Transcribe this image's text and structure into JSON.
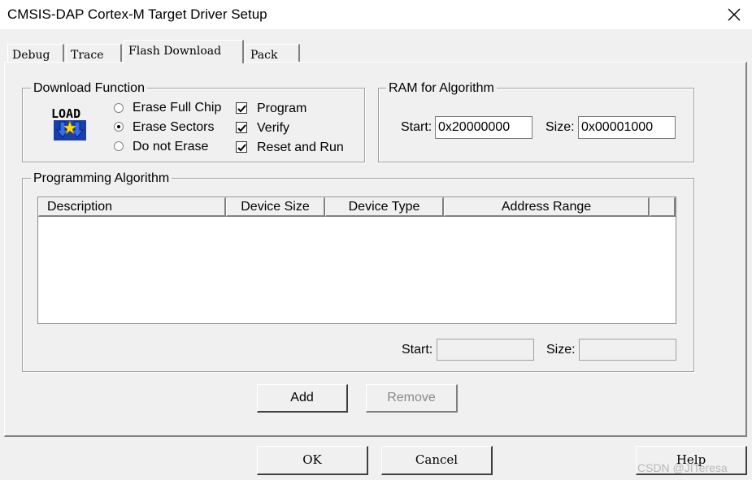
{
  "window": {
    "title": "CMSIS-DAP Cortex-M Target Driver Setup",
    "close_icon": "close-icon"
  },
  "tabs": [
    {
      "label": "Debug",
      "active": false
    },
    {
      "label": "Trace",
      "active": false
    },
    {
      "label": "Flash Download",
      "active": true
    },
    {
      "label": "Pack",
      "active": false
    }
  ],
  "download_function": {
    "label": "Download Function",
    "icon": "load-icon",
    "icon_text": "LOAD",
    "radios": [
      {
        "label": "Erase Full Chip",
        "checked": false
      },
      {
        "label": "Erase Sectors",
        "checked": true
      },
      {
        "label": "Do not Erase",
        "checked": false
      }
    ],
    "checkboxes": [
      {
        "label": "Program",
        "checked": true
      },
      {
        "label": "Verify",
        "checked": true
      },
      {
        "label": "Reset and Run",
        "checked": true
      }
    ]
  },
  "ram_for_algorithm": {
    "label": "RAM for Algorithm",
    "start_label": "Start:",
    "start_value": "0x20000000",
    "size_label": "Size:",
    "size_value": "0x00001000"
  },
  "programming_algorithm": {
    "label": "Programming Algorithm",
    "columns": [
      "Description",
      "Device Size",
      "Device Type",
      "Address Range"
    ],
    "rows": [],
    "start_label": "Start:",
    "start_value": "",
    "size_label": "Size:",
    "size_value": ""
  },
  "buttons": {
    "add": "Add",
    "remove": "Remove",
    "ok": "OK",
    "cancel": "Cancel",
    "help": "Help"
  },
  "watermark": "CSDN @JITeresa"
}
